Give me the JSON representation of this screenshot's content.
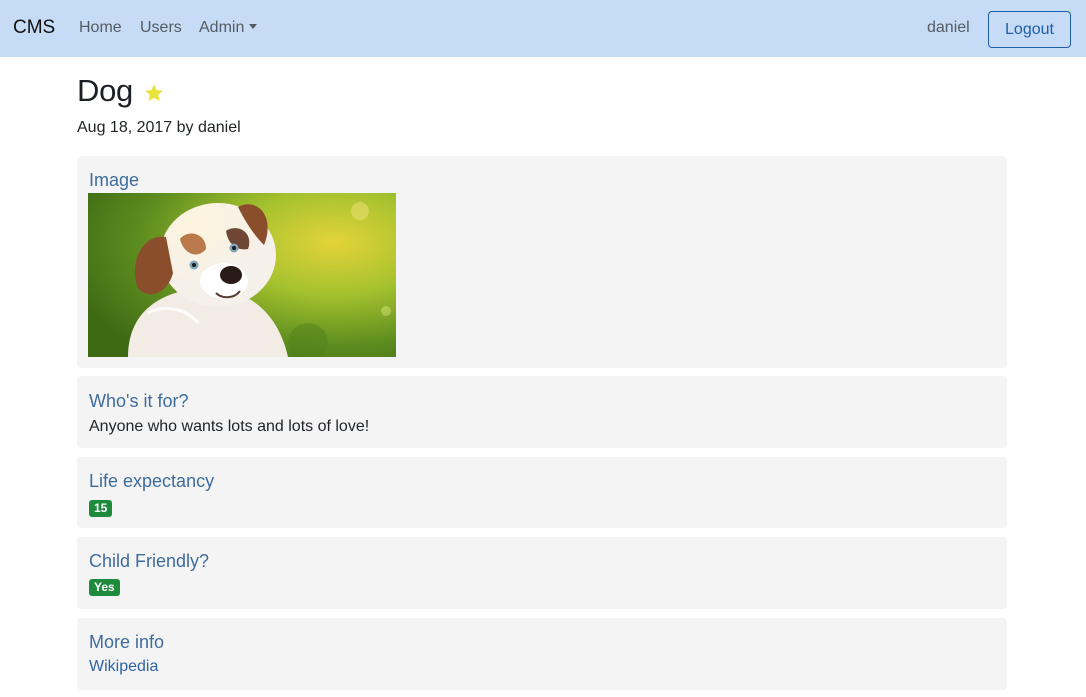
{
  "navbar": {
    "brand": "CMS",
    "links": [
      {
        "label": "Home"
      },
      {
        "label": "Users"
      },
      {
        "label": "Admin"
      }
    ],
    "user": "daniel",
    "logout_label": "Logout",
    "bg_color": "#c6dbf6"
  },
  "post": {
    "title": "Dog",
    "favorite_icon": "star-icon",
    "star_color": "#e8e23a",
    "meta": "Aug 18, 2017 by daniel"
  },
  "fields": {
    "image": {
      "heading": "Image",
      "image_icon": "dog-photo"
    },
    "audience": {
      "heading": "Who's it for?",
      "text": "Anyone who wants lots and lots of love!"
    },
    "life": {
      "heading": "Life expectancy",
      "badge": "15"
    },
    "child": {
      "heading": "Child Friendly?",
      "badge": "Yes"
    },
    "more": {
      "heading": "More info",
      "link": "Wikipedia"
    }
  },
  "colors": {
    "card_bg": "#f4f4f4",
    "heading": "#3e6c9f",
    "badge_green": "#1e8a3c",
    "link": "#2d63a6"
  }
}
